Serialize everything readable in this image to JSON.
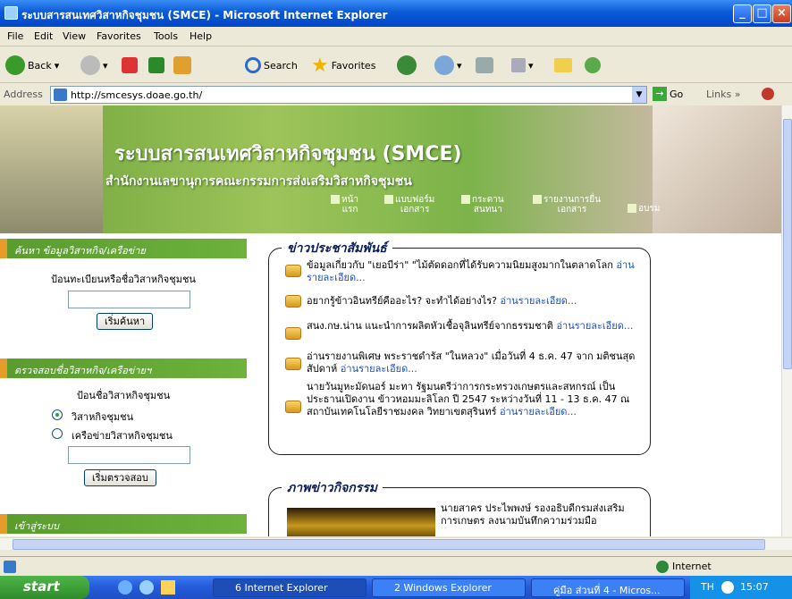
{
  "window": {
    "title": "ระบบสารสนเทศวิสาหกิจชุมชน (SMCE) - Microsoft Internet Explorer"
  },
  "menu": [
    "File",
    "Edit",
    "View",
    "Favorites",
    "Tools",
    "Help"
  ],
  "toolbar": {
    "back": "Back",
    "search": "Search",
    "favorites": "Favorites"
  },
  "address": {
    "label": "Address",
    "url": "http://smcesys.doae.go.th/",
    "go": "Go",
    "links": "Links"
  },
  "banner": {
    "title": "ระบบสารสนเทศวิสาหกิจชุมชน (SMCE)",
    "subtitle": "สำนักงานเลขานุการคณะกรรมการส่งเสริมวิสาหกิจชุมชน",
    "nav": [
      {
        "l1": "หน้า",
        "l2": "แรก"
      },
      {
        "l1": "แบบฟอร์ม",
        "l2": "เอกสาร"
      },
      {
        "l1": "กระดาน",
        "l2": "สนทนา"
      },
      {
        "l1": "รายงานการยื่น",
        "l2": "เอกสาร"
      },
      {
        "l1": "อบรม",
        "l2": ""
      }
    ]
  },
  "sidebar": {
    "search_head": "ค้นหา ข้อมูลวิสาหกิจ/เครือข่าย",
    "search_label": "ป้อนทะเบียนหรือชื่อวิสาหกิจชุมชน",
    "search_btn": "เริ่มค้นหา",
    "check_head": "ตรวจสอบชื่อวิสาหกิจ/เครือข่ายฯ",
    "check_label": "ป้อนชื่อวิสาหกิจชุมชน",
    "radio1": "วิสาหกิจชุมชน",
    "radio2": "เครือข่ายวิสาหกิจชุมชน",
    "check_btn": "เริ่มตรวจสอบ",
    "login_head": "เข้าสู่ระบบ"
  },
  "news": {
    "heading": "ข่าวประชาสัมพันธ์",
    "items": [
      {
        "text": "ข้อมูลเกี่ยวกับ \"เยอบีร่า\" \"ไม้ตัดดอกที่ได้รับความนิยมสูงมากในตลาดโลก",
        "link": "อ่านรายละเอียด..."
      },
      {
        "text": "อยากรู้ข้าวอินทรีย์คืออะไร? จะทำได้อย่างไร?",
        "link": "อ่านรายละเอียด..."
      },
      {
        "text": "สนง.กษ.น่าน แนะนำการผลิตหัวเชื้อจุลินทรีย์จากธรรมชาติ",
        "link": "อ่านรายละเอียด..."
      },
      {
        "text": "อ่านรายงานพิเศษ พระราชดำรัส \"ในหลวง\" เมื่อวันที่ 4 ธ.ค. 47 จาก มติชนสุดสัปดาห์",
        "link": "อ่านรายละเอียด..."
      },
      {
        "text": "นายวันมูหะมัดนอร์ มะทา รัฐมนตรีว่าการกระทรวงเกษตรและสหกรณ์ เป็นประธานเปิดงาน ข้าวหอมมะลิโลก ปี 2547 ระหว่างวันที่ 11 - 13 ธ.ค. 47 ณ สถาบันเทคโนโลยีราชมงคล วิทยาเขตสุรินทร์",
        "link": "อ่านรายละเอียด..."
      }
    ]
  },
  "activity": {
    "heading": "ภาพข่าวกิจกรรม",
    "text": "นายสาคร ประไพพงษ์ รองอธิบดีกรมส่งเสริมการเกษตร ลงนามบันทึกความร่วมมือ"
  },
  "status": {
    "zone": "Internet"
  },
  "taskbar": {
    "start": "start",
    "tasks": [
      "6 Internet Explorer",
      "2 Windows Explorer",
      "คู่มือ ส่วนที่ 4 - Micros..."
    ],
    "lang": "TH",
    "clock": "15:07"
  }
}
